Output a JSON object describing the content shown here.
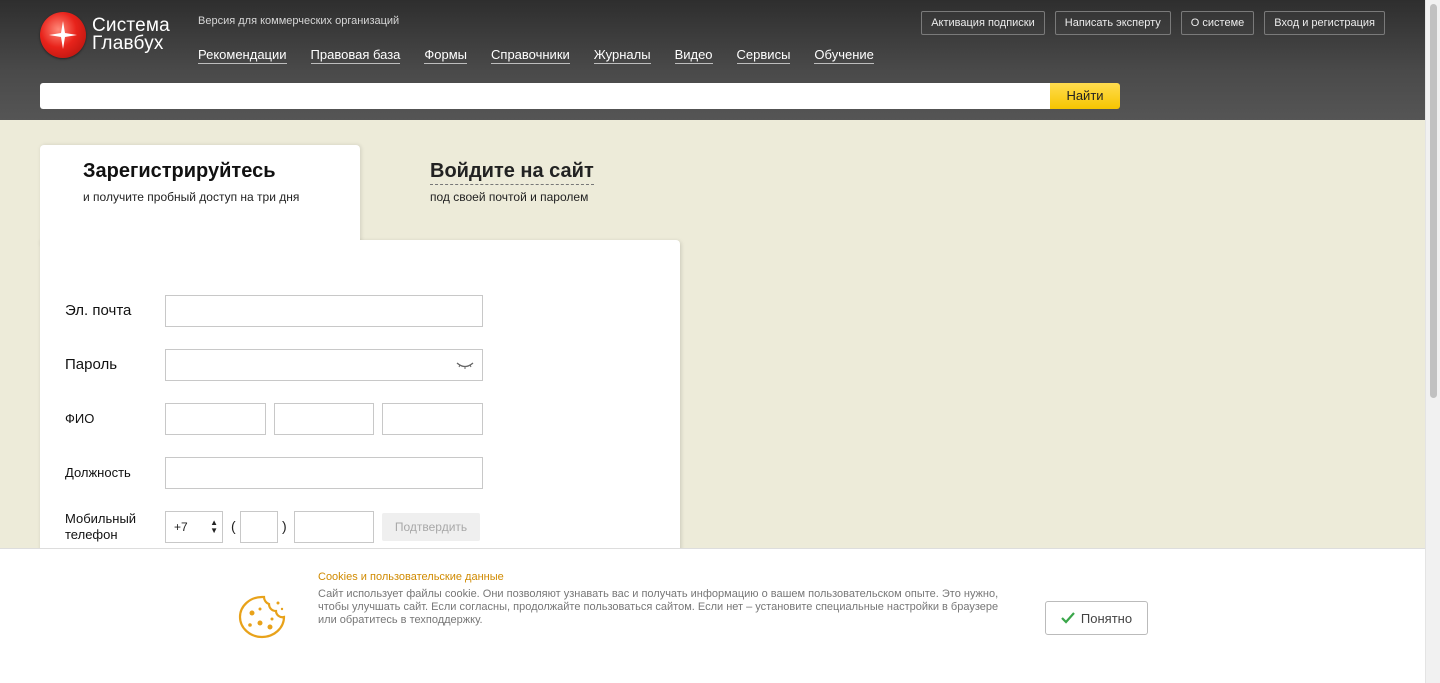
{
  "logo": {
    "line1": "Система",
    "line2": "Главбух"
  },
  "header": {
    "version_text": "Версия для коммерческих организаций",
    "nav": [
      "Рекомендации",
      "Правовая база",
      "Формы",
      "Справочники",
      "Журналы",
      "Видео",
      "Сервисы",
      "Обучение"
    ],
    "top_buttons": [
      "Активация подписки",
      "Написать эксперту",
      "О системе",
      "Вход и регистрация"
    ],
    "search": {
      "value": "",
      "button_label": "Найти"
    }
  },
  "tabs": {
    "register": {
      "title": "Зарегистрируйтесь",
      "subtitle": "и получите пробный доступ на три дня"
    },
    "login": {
      "title": "Войдите на сайт",
      "subtitle": "под своей почтой и паролем"
    }
  },
  "form": {
    "email_label": "Эл. почта",
    "password_label": "Пароль",
    "fio_label": "ФИО",
    "position_label": "Должность",
    "phone_label_line1": "Мобильный",
    "phone_label_line2": "телефон",
    "phone_code": "+7",
    "paren_open": "(",
    "paren_close": ")",
    "confirm_label": "Подтвердить"
  },
  "cookie": {
    "title": "Cookies и пользовательские данные",
    "text": "Сайт использует файлы cookie. Они позволяют узнавать вас и получать информацию о вашем пользовательском опыте. Это нужно, чтобы улучшать сайт. Если согласны, продолжайте пользоваться сайтом. Если нет – установите специальные настройки в браузере или обратитесь в техподдержку.",
    "button_label": "Понятно"
  },
  "colors": {
    "accent_yellow": "#f6c500",
    "cookie_orange": "#d08a00",
    "logo_red": "#e8231b",
    "check_green": "#3aa64a"
  }
}
